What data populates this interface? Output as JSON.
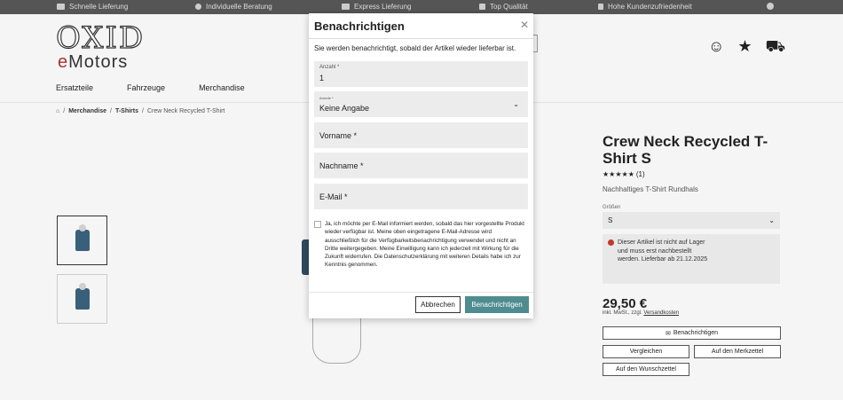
{
  "topbar": {
    "items": [
      {
        "label": "Schnelle Lieferung",
        "icon": "truck-icon"
      },
      {
        "label": "Individuelle Beratung",
        "icon": "headset-icon"
      },
      {
        "label": "Express Lieferung",
        "icon": "express-truck-icon"
      },
      {
        "label": "Top Qualität",
        "icon": "badge-icon"
      },
      {
        "label": "Hohe Kundenzufriedenheit",
        "icon": "thumbs-up-icon"
      }
    ]
  },
  "header": {
    "logo_top": "OXID",
    "logo_e": "e",
    "logo_rest": "Motors",
    "nav": [
      "Ersatzteile",
      "Fahrzeuge",
      "Merchandise"
    ]
  },
  "breadcrumb": {
    "sep": "/",
    "items": [
      "Merchandise",
      "T-Shirts",
      "Crew Neck Recycled T-Shirt"
    ]
  },
  "product": {
    "title": "Crew Neck Recycled T-Shirt S",
    "rating_stars": "★★★★★",
    "rating_count": "(1)",
    "subtitle": "Nachhaltiges T-Shirt Rundhals",
    "size_label": "Größen",
    "size_value": "S",
    "stock_text": "Dieser Artikel ist nicht auf Lager und muss erst nachbestellt werden. Lieferbar ab 21.12.2025",
    "price": "29,50 €",
    "price_note_prefix": "inkl. MwSt., zzgl.",
    "price_note_link": "Versandkosten",
    "btn_notify": "Benachrichtigen",
    "btn_compare": "Vergleichen",
    "btn_watchlist": "Auf den Merkzettel",
    "btn_wishlist": "Auf den Wunschzettel"
  },
  "modal": {
    "title": "Benachrichtigen",
    "intro": "Sie werden benachrichtigt, sobald der Artikel wieder lieferbar ist.",
    "qty_label": "Anzahl *",
    "qty_value": "1",
    "salutation_label": "Anrede *",
    "salutation_value": "Keine Angabe",
    "firstname_placeholder": "Vorname *",
    "lastname_placeholder": "Nachname *",
    "email_placeholder": "E-Mail *",
    "consent": "Ja, ich möchte per E-Mail informiert werden, sobald das hier vorgestellte Produkt wieder verfügbar ist. Meine oben eingetragene E-Mail-Adresse wird ausschließlich für die Verfügbarkeitsbenachrichtigung verwendet und nicht an Dritte weitergegeben. Meine Einwilligung kann ich jederzeit mit Wirkung für die Zukunft widerrufen. Die Datenschutzerklärung mit weiteren Details habe ich zur Kenntnis genommen.",
    "cancel": "Abbrechen",
    "submit": "Benachrichtigen"
  }
}
